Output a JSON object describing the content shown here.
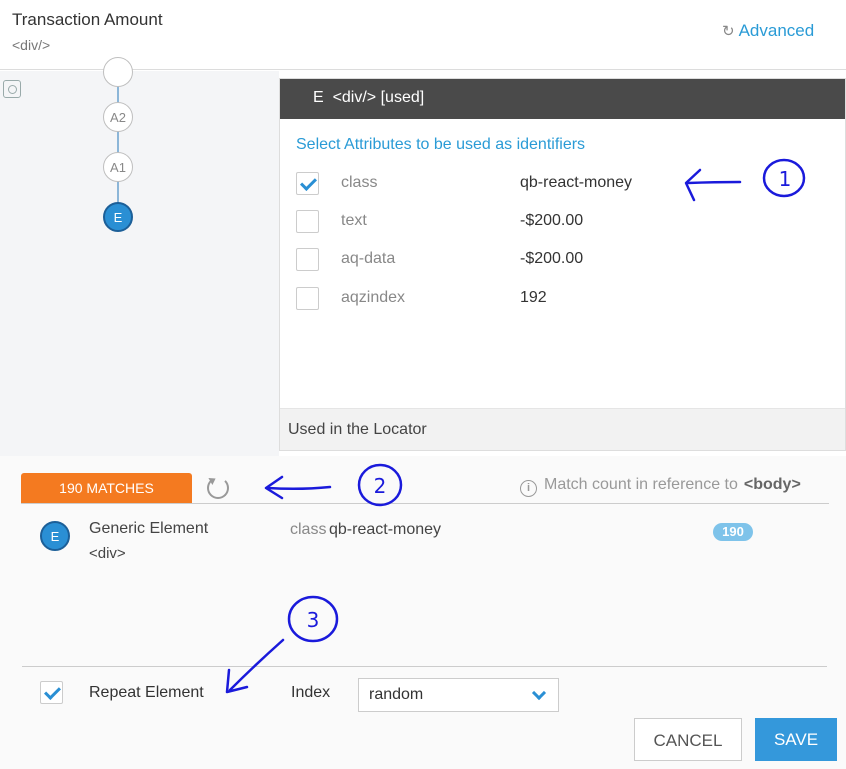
{
  "header": {
    "title": "Transaction Amount",
    "subtitle": "<div/>",
    "advanced_label": "Advanced",
    "advanced_icon": "undo-arrow-icon"
  },
  "tree": {
    "nodes": [
      {
        "label": "A2"
      },
      {
        "label": "A1"
      },
      {
        "label": "E"
      }
    ]
  },
  "panel": {
    "title": "E  <div/> [used]",
    "attributes_heading": "Select Attributes to be used as identifiers",
    "attributes": [
      {
        "name": "class",
        "value": "qb-react-money",
        "checked": true
      },
      {
        "name": "text",
        "value": "-$200.00",
        "checked": false
      },
      {
        "name": "aq-data",
        "value": "-$200.00",
        "checked": false
      },
      {
        "name": "aqzindex",
        "value": "192",
        "checked": false
      }
    ],
    "used_label": "Used in the Locator"
  },
  "matches": {
    "tab_label": "190 MATCHES",
    "reference_text": "Match count in reference to",
    "reference_tag": "<body>",
    "result": {
      "icon_label": "E",
      "name": "Generic Element",
      "tag": "<div>",
      "attr_key": "class",
      "attr_value": "qb-react-money",
      "count": "190"
    }
  },
  "footer": {
    "repeat_label": "Repeat Element",
    "repeat_checked": true,
    "index_label": "Index",
    "index_value": "random",
    "cancel_label": "CANCEL",
    "save_label": "SAVE"
  },
  "annotations": {
    "marks": [
      "1",
      "2",
      "3"
    ],
    "ink_color": "#1a1adb"
  },
  "colors": {
    "accent": "#2a9bd6",
    "matches_tab": "#f47a20",
    "panel_header": "#4a4a4a",
    "save": "#3498db"
  }
}
